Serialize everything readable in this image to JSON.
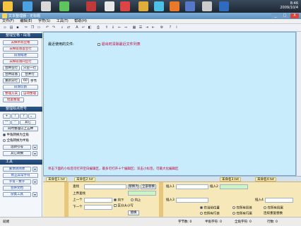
{
  "taskbar": {
    "time": "8:46",
    "date": "2009/10/4"
  },
  "window": {
    "title": "文本整理器 - 无标题",
    "min": "_",
    "max": "□",
    "close": "X"
  },
  "menu": [
    "文件(F)",
    "编辑(E)",
    "字符(S)",
    "工具(T)",
    "帮助(H)"
  ],
  "sidebar": {
    "sec1": "整理空格・段落",
    "b_rm_empty": "去掉所有空格",
    "b_rm_first": "去掉段落首空行",
    "b_para_indent": "段落缩进",
    "b_rm_para_blank": "去掉段落间空行",
    "b_merge_blank": "合并空行",
    "b_one_blank": "只空一行",
    "b_merge_para": "合并段落",
    "b_merge_line": "合并行",
    "b_resplit": "重新分行",
    "resplit_value": "60",
    "resplit_unit": "字节",
    "b_cut_para": "段落切割",
    "b_plan": "整理方案",
    "b_auto": "自动整理",
    "b_batch": "批量整理",
    "sec2": "整理标点符号",
    "p1": "+",
    "p2": "!",
    "p3": "?",
    "p4": "。",
    "p5": "\"\"",
    "p6": "''",
    "p7": "其它",
    "b_half_to_full": "同时整理以上五种",
    "r1": "半角转换为全角",
    "r2": "全角转换为半角",
    "b_quote": "逗转引号",
    "b_other_conv": "其它转换",
    "sec3": "工具",
    "b_trad": "繁体转简体",
    "b_fix_bad": "修正异常字符",
    "b_letters": "字母・数字",
    "b_merge_doc": "合并文档",
    "b_misc": "杂类工具"
  },
  "main": {
    "recent_label": "最近使用的文件:",
    "clear_recent": "退出时清除最近文件列表",
    "hint": "单击下面的小标签可打开空白编辑区，最多可打开十个编辑区；双击小标签，可最大化编辑区"
  },
  "tabs": [
    "未命名1.txt",
    "未命名2.txt",
    "未命名3.txt",
    "未命名4.txt"
  ],
  "tabs_right": [
    "未命名3.txt",
    "未命名4.txt"
  ],
  "bottom": {
    "find_label": "查找",
    "replace_label": "替换为",
    "replace_all": "全部替换",
    "prev": "上一个",
    "next": "下一个",
    "upper": "上界查找",
    "lower": "下界查找",
    "down": "向下",
    "up": "向上",
    "case": "区分大小写",
    "exec": "替换",
    "insert1": "插入1",
    "insert2": "插入2",
    "insert3": "插入3",
    "insert4": "插入4",
    "at_cursor": "在当前位置",
    "at_start": "在所有段首",
    "at_end": "在所有段尾",
    "at_linestart": "在所有行首",
    "at_lineend": "在所有行尾",
    "replace_repeat": "连续重复替换"
  },
  "status": {
    "s1": "就绪",
    "s2": "字节数: 0",
    "s3": "半角字符: 0",
    "s4": "全角字符: 0",
    "s5": "行数: 0"
  }
}
